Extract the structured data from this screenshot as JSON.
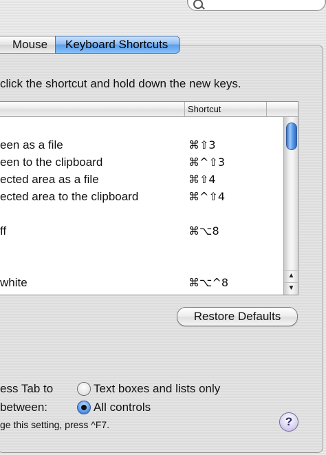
{
  "search": {
    "placeholder": ""
  },
  "tabs": [
    {
      "label": "Mouse"
    },
    {
      "label": "Keyboard Shortcuts",
      "selected": true
    }
  ],
  "instructions": "click the shortcut and hold down the new keys.",
  "table": {
    "header_shortcut": "Shortcut",
    "rows": [
      {
        "action": "een as a file",
        "shortcut": "⌘⇧3"
      },
      {
        "action": "een to the clipboard",
        "shortcut": "⌘^⇧3"
      },
      {
        "action": "ected area as a file",
        "shortcut": "⌘⇧4"
      },
      {
        "action": "ected area to the clipboard",
        "shortcut": "⌘^⇧4"
      },
      {
        "action": "ff",
        "shortcut": "⌘⌥8"
      },
      {
        "action": "white",
        "shortcut": "⌘⌥^8"
      }
    ]
  },
  "restore_button": "Restore Defaults",
  "full_keyboard_access": {
    "line1": "ess Tab to",
    "line2": "between:",
    "options": [
      {
        "label": "Text boxes and lists only",
        "selected": false
      },
      {
        "label": "All controls",
        "selected": true
      }
    ],
    "note": "ge this setting, press ^F7."
  },
  "help_button": "?",
  "colors": {
    "accent": "#5c9ee8"
  },
  "icons": [
    "search-icon",
    "scroll-up-arrow-icon",
    "scroll-down-arrow-icon",
    "help-icon"
  ]
}
